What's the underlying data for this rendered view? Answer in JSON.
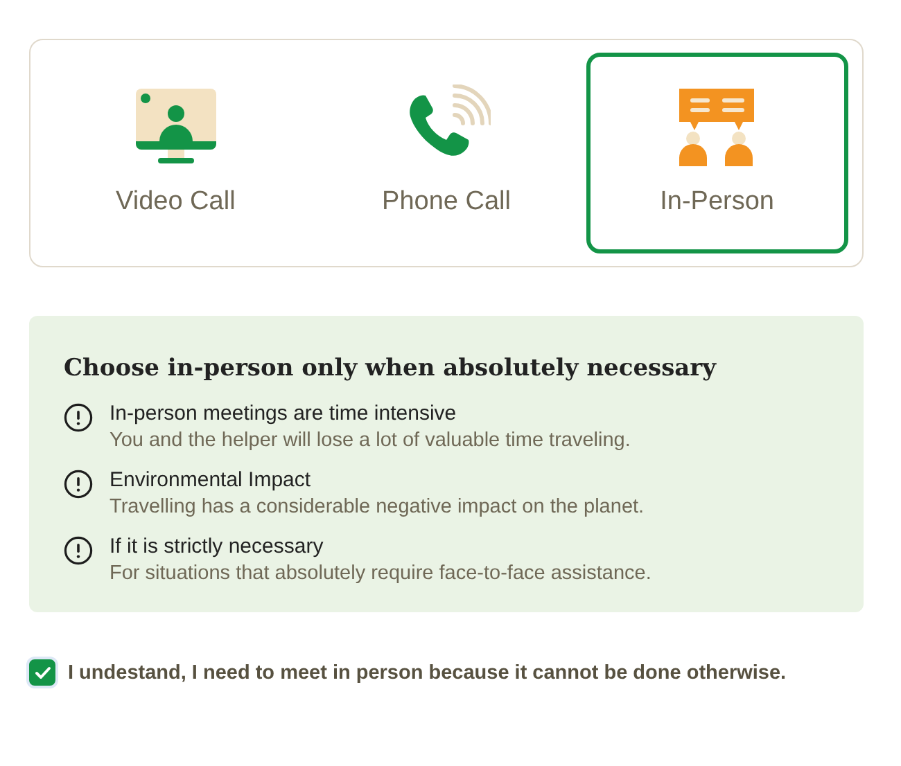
{
  "options": [
    {
      "kind": "video",
      "label": "Video Call",
      "selected": false
    },
    {
      "kind": "phone",
      "label": "Phone Call",
      "selected": false
    },
    {
      "kind": "person",
      "label": "In-Person",
      "selected": true
    }
  ],
  "notice": {
    "title": "Choose in-person only when absolutely necessary",
    "items": [
      {
        "title": "In-person meetings are time intensive",
        "text": "You and the helper will lose a lot of valuable time traveling."
      },
      {
        "title": "Environmental Impact",
        "text": "Travelling has a considerable negative impact on the planet."
      },
      {
        "title": "If it is strictly necessary",
        "text": "For situations that absolutely require face-to-face assistance."
      }
    ]
  },
  "confirm": {
    "label": "I undestand, I need to meet in person because it cannot be done otherwise.",
    "checked": true
  }
}
